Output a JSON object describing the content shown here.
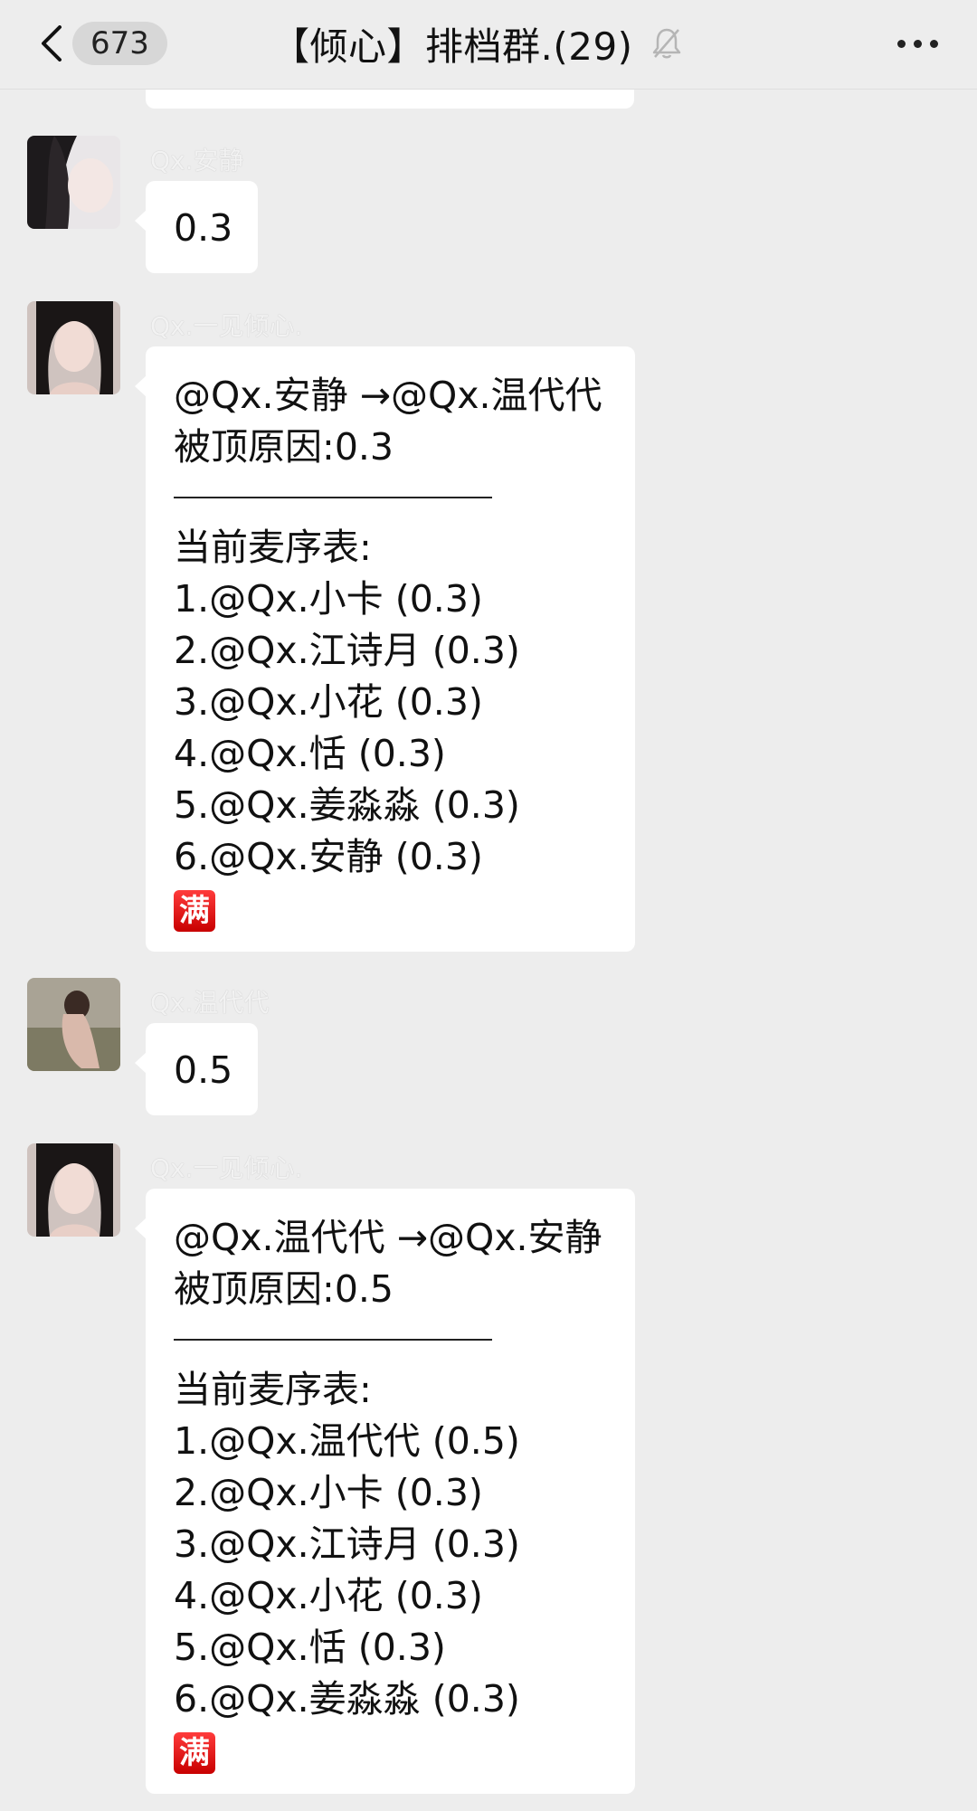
{
  "header": {
    "unread_count": "673",
    "title": "【倾心】排档群.(29)",
    "mute_icon": "bell-off-icon",
    "more_icon": "more-dots-icon"
  },
  "messages": [
    {
      "sender": "Qx.安静",
      "lines": [
        "0.3"
      ]
    },
    {
      "sender": "Qx.一见倾心.",
      "header_lines": [
        "@Qx.安静 →@Qx.温代代",
        "被顶原因:0.3"
      ],
      "list_title": "当前麦序表:",
      "list": [
        "1.@Qx.小卡 (0.3)",
        "2.@Qx.江诗月 (0.3)",
        "3.@Qx.小花 (0.3)",
        "4.@Qx.恬 (0.3)",
        "5.@Qx.姜淼淼 (0.3)",
        "6.@Qx.安静 (0.3)"
      ],
      "badge": "满"
    },
    {
      "sender": "Qx.温代代",
      "lines": [
        "0.5"
      ]
    },
    {
      "sender": "Qx.一见倾心.",
      "header_lines": [
        "@Qx.温代代 →@Qx.安静",
        "被顶原因:0.5"
      ],
      "list_title": "当前麦序表:",
      "list": [
        "1.@Qx.温代代 (0.5)",
        "2.@Qx.小卡 (0.3)",
        "3.@Qx.江诗月 (0.3)",
        "4.@Qx.小花 (0.3)",
        "5.@Qx.恬 (0.3)",
        "6.@Qx.姜淼淼 (0.3)"
      ],
      "badge": "满"
    }
  ]
}
